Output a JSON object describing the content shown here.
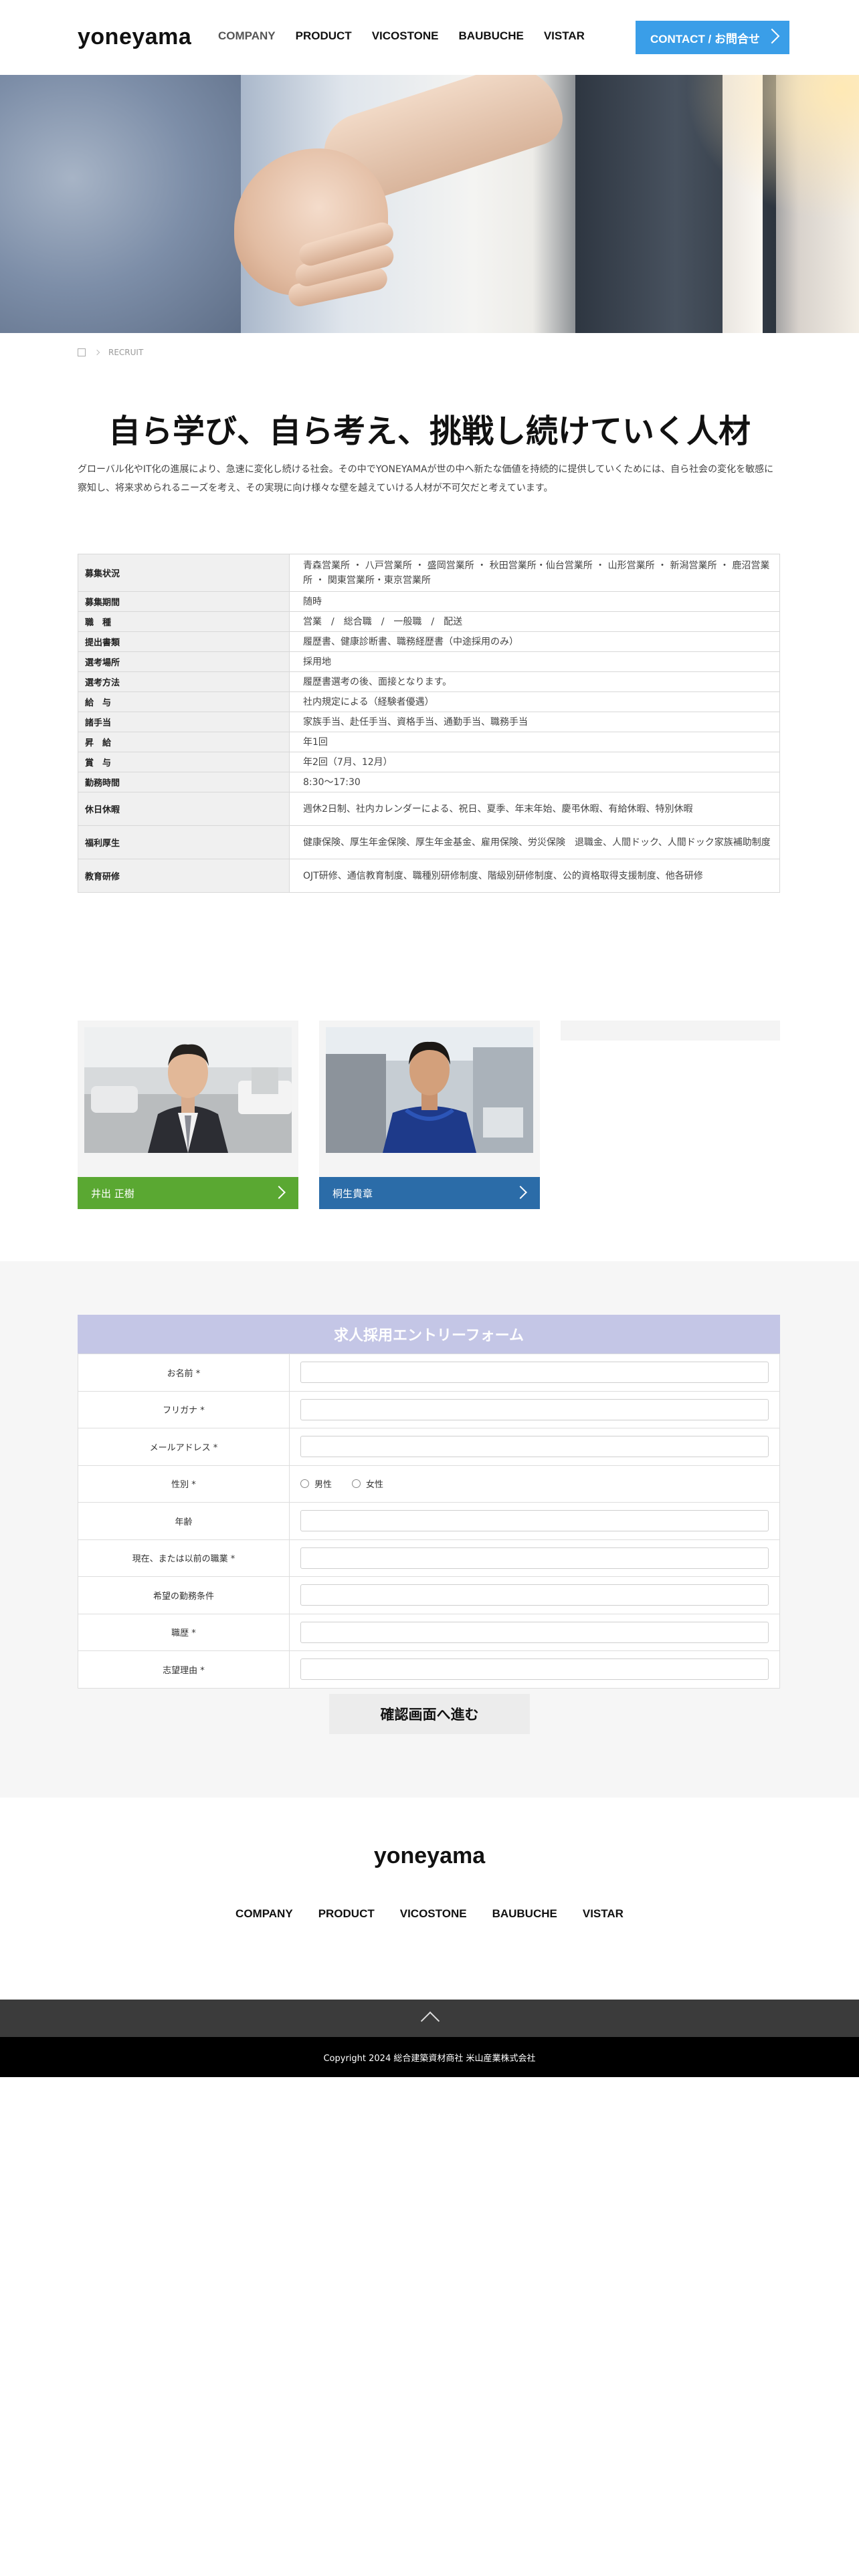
{
  "header": {
    "logo": "yoneyama",
    "nav": [
      "COMPANY",
      "PRODUCT",
      "VICOSTONE",
      "BAUBUCHE",
      "VISTAR"
    ],
    "contact_label": "CONTACT / お問合せ"
  },
  "breadcrumb": {
    "current": "RECRUIT"
  },
  "intro": {
    "title": "自ら学び、自ら考え、挑戦し続けていく人材",
    "text": "グローバル化やIT化の進展により、急速に変化し続ける社会。その中でYONEYAMAが世の中へ新たな価値を持続的に提供していくためには、自ら社会の変化を敏感に察知し、将来求められるニーズを考え、その実現に向け様々な壁を越えていける人材が不可欠だと考えています。"
  },
  "recruit_table": [
    {
      "label": "募集状況",
      "value": "青森営業所 ・ 八戸営業所 ・ 盛岡営業所 ・ 秋田営業所・仙台営業所 ・ 山形営業所 ・ 新潟営業所 ・ 鹿沼営業所 ・ 関東営業所・東京営業所"
    },
    {
      "label": "募集期間",
      "value": "随時"
    },
    {
      "label": "職　種",
      "value": "営業　/　総合職　/　一般職　/　配送"
    },
    {
      "label": "提出書類",
      "value": "履歴書、健康診断書、職務経歴書（中途採用のみ）"
    },
    {
      "label": "選考場所",
      "value": "採用地"
    },
    {
      "label": "選考方法",
      "value": "履歴書選考の後、面接となります。"
    },
    {
      "label": "給　与",
      "value": "社内規定による（経験者優遇）"
    },
    {
      "label": "諸手当",
      "value": "家族手当、赴任手当、資格手当、通勤手当、職務手当"
    },
    {
      "label": "昇　給",
      "value": "年1回"
    },
    {
      "label": "賞　与",
      "value": "年2回（7月、12月）"
    },
    {
      "label": "勤務時間",
      "value": "8:30〜17:30"
    },
    {
      "label": "休日休暇",
      "value": "週休2日制、社内カレンダーによる、祝日、夏季、年末年始、慶弔休暇、有給休暇、特別休暇"
    },
    {
      "label": "福利厚生",
      "value": "健康保険、厚生年金保険、厚生年金基金、雇用保険、労災保険　退職金、人間ドック、人間ドック家族補助制度"
    },
    {
      "label": "教育研修",
      "value": "OJT研修、通信教育制度、職種別研修制度、階級別研修制度、公的資格取得支援制度、他各研修"
    }
  ],
  "staff": [
    {
      "name": "井出 正樹",
      "color": "#5aa832"
    },
    {
      "name": "桐生貴章",
      "color": "#2b6ca8"
    }
  ],
  "form": {
    "title": "求人採用エントリーフォーム",
    "fields": [
      {
        "label": "お名前 *"
      },
      {
        "label": "フリガナ *"
      },
      {
        "label": "メールアドレス *"
      },
      {
        "label": "性別 *"
      },
      {
        "label": "年齢"
      },
      {
        "label": "現在、または以前の職業 *"
      },
      {
        "label": "希望の勤務条件"
      },
      {
        "label": "職歴 *"
      },
      {
        "label": "志望理由 *"
      }
    ],
    "gender_options": [
      "男性",
      "女性"
    ],
    "submit_label": "確認画面へ進む"
  },
  "footer": {
    "logo": "yoneyama",
    "nav": [
      "COMPANY",
      "PRODUCT",
      "VICOSTONE",
      "BAUBUCHE",
      "VISTAR"
    ],
    "copyright": "Copyright 2024 総合建築資材商社 米山産業株式会社"
  }
}
